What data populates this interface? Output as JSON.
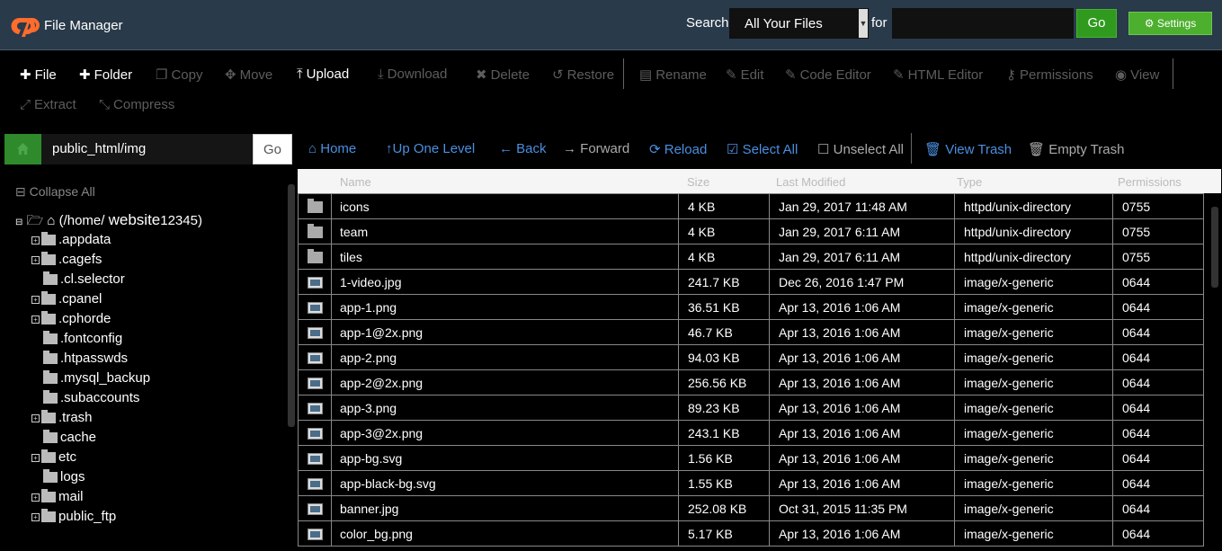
{
  "header": {
    "app_title": "File Manager",
    "search_label": "Search",
    "search_scope": "All Your Files",
    "for_label": "for",
    "search_value": "",
    "go_label": "Go",
    "settings_label": "Settings"
  },
  "toolbar": {
    "file": "File",
    "folder": "Folder",
    "copy": "Copy",
    "move": "Move",
    "upload": "Upload",
    "download": "Download",
    "delete": "Delete",
    "restore": "Restore",
    "rename": "Rename",
    "edit": "Edit",
    "code_editor": "Code Editor",
    "html_editor": "HTML Editor",
    "permissions": "Permissions",
    "view": "View",
    "extract": "Extract",
    "compress": "Compress"
  },
  "path": {
    "value": "public_html/img",
    "go_label": "Go"
  },
  "nav": {
    "home": "Home",
    "up_one_level": "Up One Level",
    "back": "Back",
    "forward": "Forward",
    "reload": "Reload",
    "select_all": "Select All",
    "unselect_all": "Unselect All",
    "view_trash": "View Trash",
    "empty_trash": "Empty Trash"
  },
  "tree": {
    "collapse_all": "Collapse All",
    "root_prefix": "(/home/",
    "root_user": "website",
    "root_suffix": "12345)",
    "items": [
      ".appdata",
      ".cagefs",
      ".cl.selector",
      ".cpanel",
      ".cphorde",
      ".fontconfig",
      ".htpasswds",
      ".mysql_backup",
      ".subaccounts",
      ".trash",
      "cache",
      "etc",
      "logs",
      "mail",
      "public_ftp"
    ]
  },
  "table": {
    "headers": [
      "Name",
      "Size",
      "Last Modified",
      "Type",
      "Permissions"
    ],
    "rows": [
      [
        "icons",
        "4 KB",
        "Jan 29, 2017 11:48 AM",
        "httpd/unix-directory",
        "0755"
      ],
      [
        "team",
        "4 KB",
        "Jan 29, 2017 6:11 AM",
        "httpd/unix-directory",
        "0755"
      ],
      [
        "tiles",
        "4 KB",
        "Jan 29, 2017 6:11 AM",
        "httpd/unix-directory",
        "0755"
      ],
      [
        "1-video.jpg",
        "241.7 KB",
        "Dec 26, 2016 1:47 PM",
        "image/x-generic",
        "0644"
      ],
      [
        "app-1.png",
        "36.51 KB",
        "Apr 13, 2016 1:06 AM",
        "image/x-generic",
        "0644"
      ],
      [
        "app-1@2x.png",
        "46.7 KB",
        "Apr 13, 2016 1:06 AM",
        "image/x-generic",
        "0644"
      ],
      [
        "app-2.png",
        "94.03 KB",
        "Apr 13, 2016 1:06 AM",
        "image/x-generic",
        "0644"
      ],
      [
        "app-2@2x.png",
        "256.56 KB",
        "Apr 13, 2016 1:06 AM",
        "image/x-generic",
        "0644"
      ],
      [
        "app-3.png",
        "89.23 KB",
        "Apr 13, 2016 1:06 AM",
        "image/x-generic",
        "0644"
      ],
      [
        "app-3@2x.png",
        "243.1 KB",
        "Apr 13, 2016 1:06 AM",
        "image/x-generic",
        "0644"
      ],
      [
        "app-bg.svg",
        "1.56 KB",
        "Apr 13, 2016 1:06 AM",
        "image/x-generic",
        "0644"
      ],
      [
        "app-black-bg.svg",
        "1.55 KB",
        "Apr 13, 2016 1:06 AM",
        "image/x-generic",
        "0644"
      ],
      [
        "banner.jpg",
        "252.08 KB",
        "Oct 31, 2015 11:35 PM",
        "image/x-generic",
        "0644"
      ],
      [
        "color_bg.png",
        "5.17 KB",
        "Apr 13, 2016 1:06 AM",
        "image/x-generic",
        "0644"
      ]
    ]
  },
  "colors": {
    "header_bg": "#293a4a",
    "accent_green": "#4caf2e",
    "link_blue": "#4a8fe0"
  }
}
